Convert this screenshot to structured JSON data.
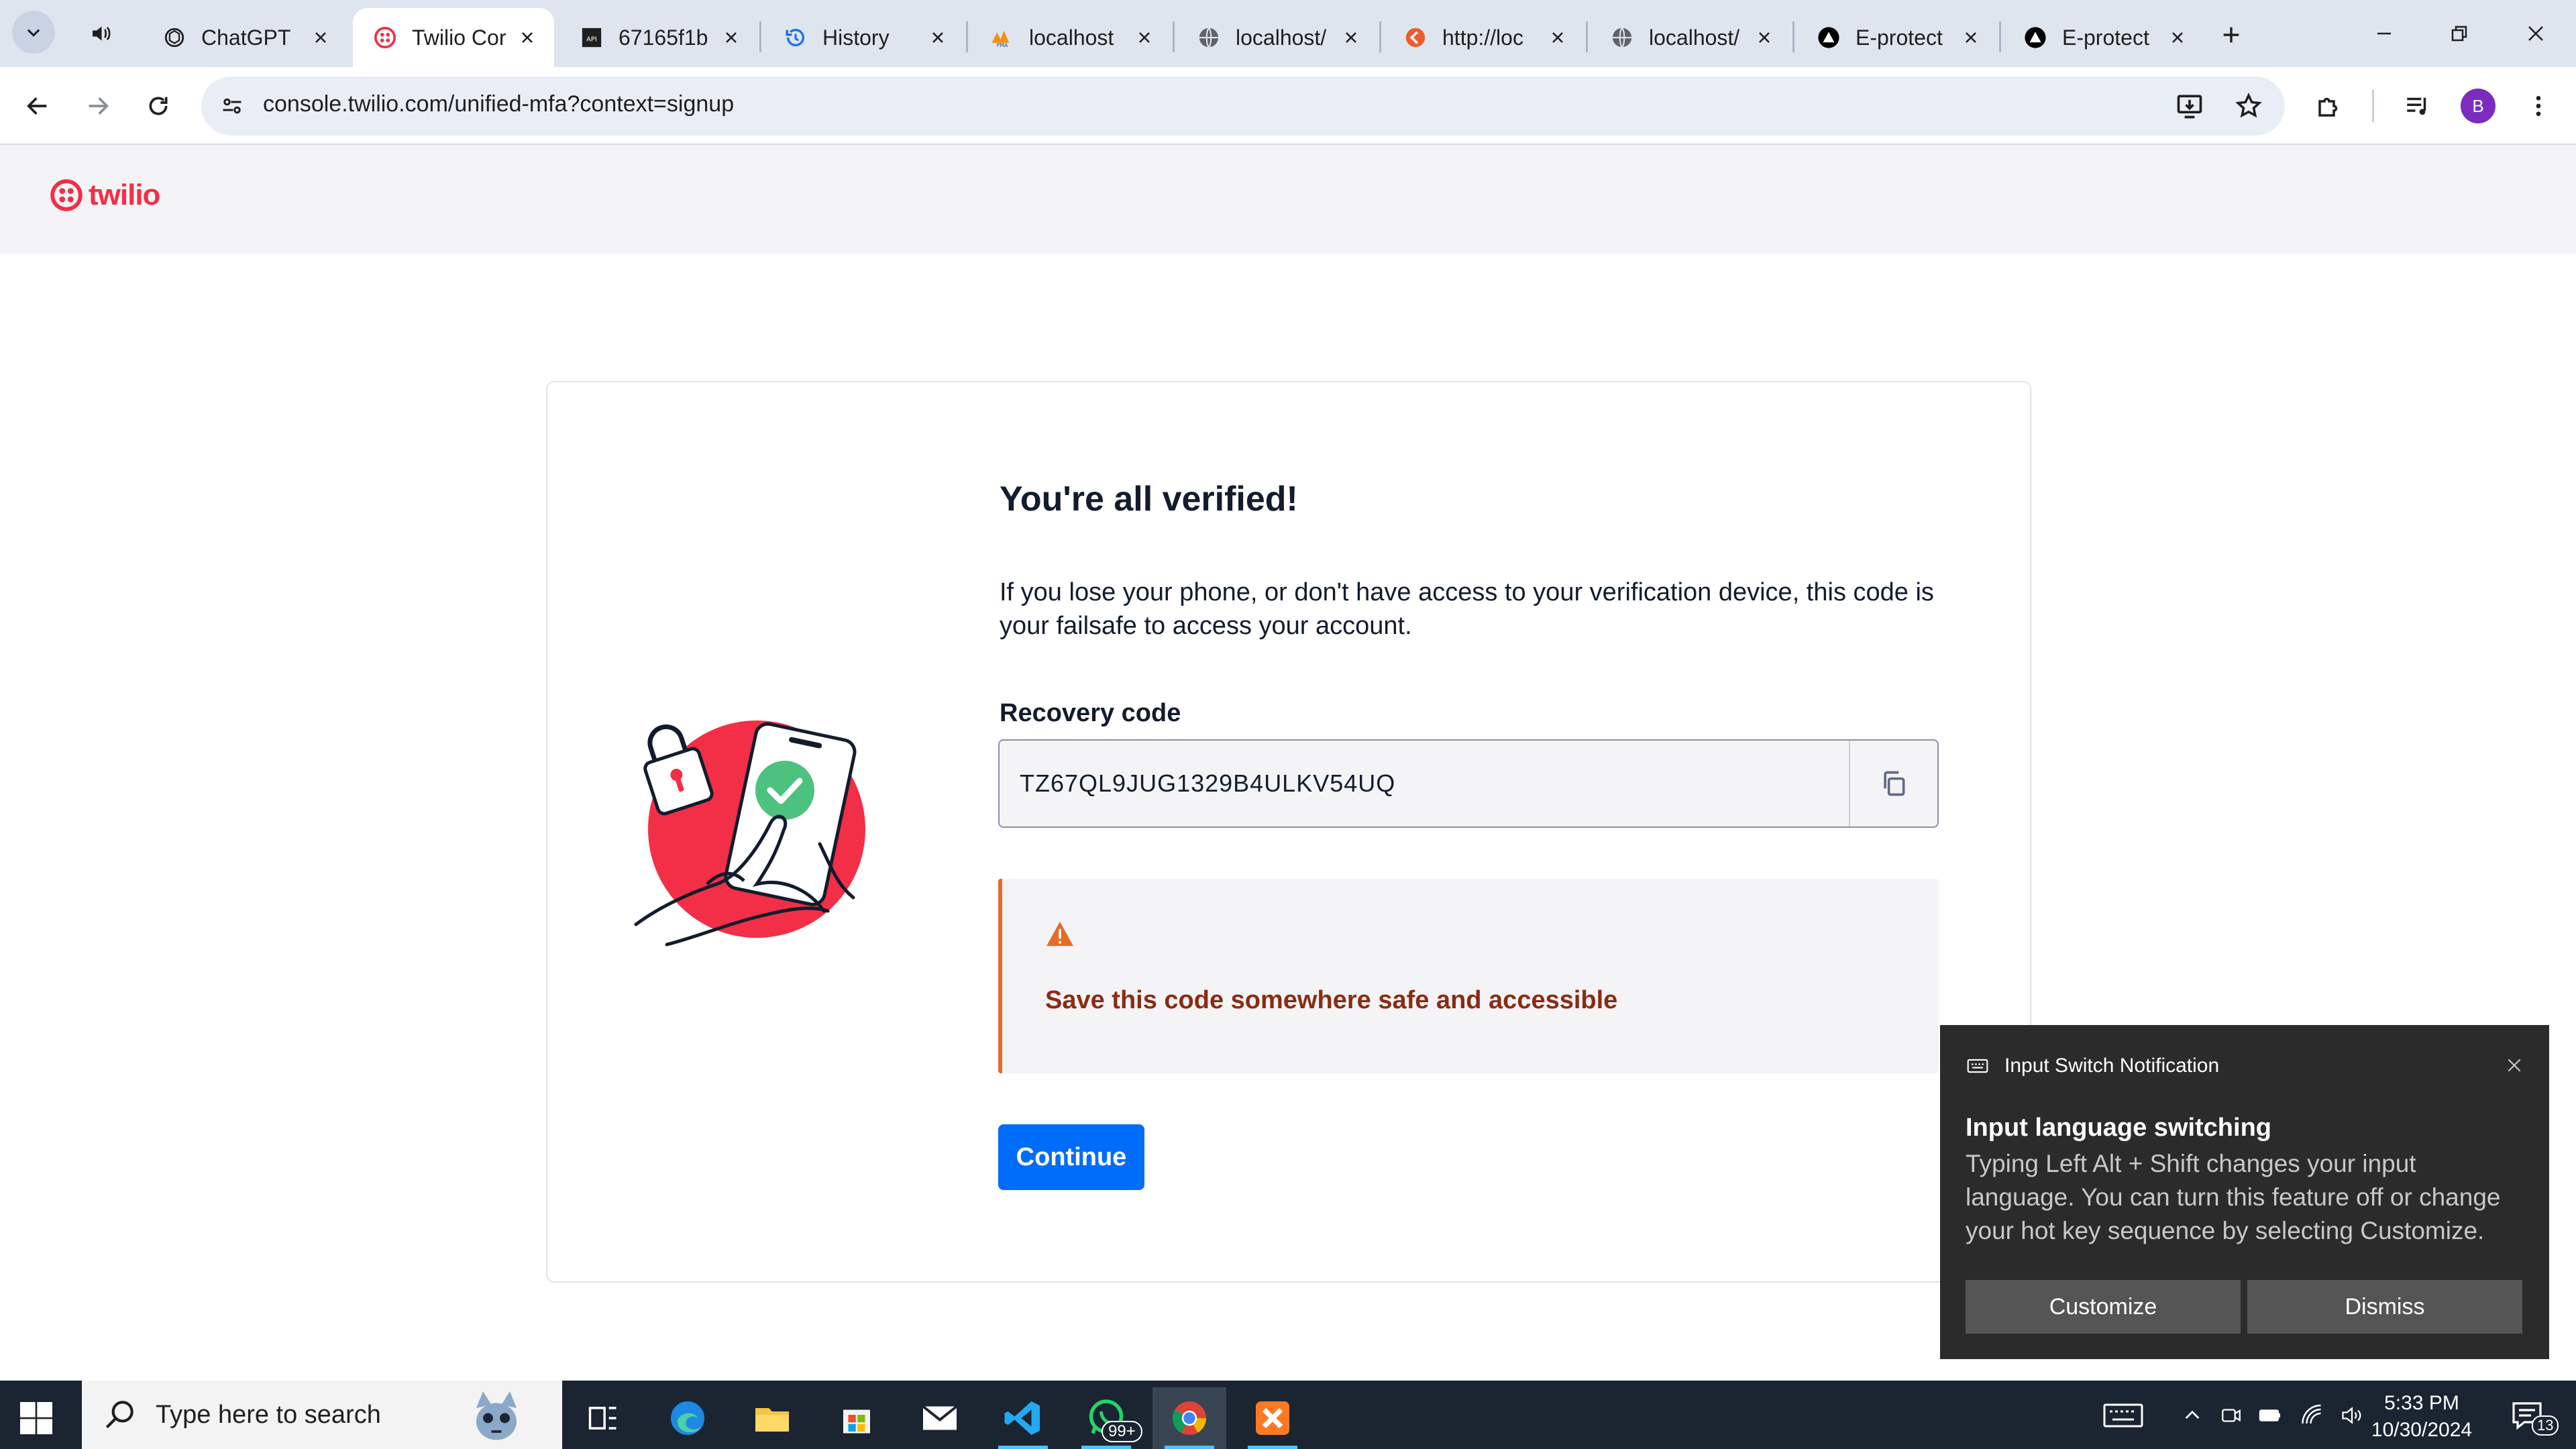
{
  "browser": {
    "tabs": [
      {
        "title": "ChatGPT",
        "icon": "chatgpt-icon"
      },
      {
        "title": "Twilio Cor",
        "icon": "twilio-icon",
        "active": true
      },
      {
        "title": "67165f1b",
        "icon": "api-doc-icon"
      },
      {
        "title": "History",
        "icon": "history-icon"
      },
      {
        "title": "localhost",
        "icon": "phpmyadmin-icon"
      },
      {
        "title": "localhost/",
        "icon": "globe-icon"
      },
      {
        "title": "http://loc",
        "icon": "red-app-icon"
      },
      {
        "title": "localhost/",
        "icon": "globe-icon"
      },
      {
        "title": "E-protect",
        "icon": "triangle-app-icon"
      },
      {
        "title": "E-protect",
        "icon": "triangle-app-icon"
      }
    ],
    "url": "console.twilio.com/unified-mfa?context=signup",
    "profile_initial": "B"
  },
  "header": {
    "logo_text": "twilio"
  },
  "card": {
    "heading": "You're all verified!",
    "description": "If you lose your phone, or don't have access to your verification device, this code is your failsafe to access your account.",
    "code_label": "Recovery code",
    "code_value": "TZ67QL9JUG1329B4ULKV54UQ",
    "warning": "Save this code somewhere safe and accessible",
    "continue_label": "Continue"
  },
  "notification": {
    "app_name": "Input Switch Notification",
    "title": "Input language switching",
    "body": "Typing Left Alt + Shift changes your input language. You can turn this feature off or change your hot key sequence by selecting Customize.",
    "customize_label": "Customize",
    "dismiss_label": "Dismiss"
  },
  "taskbar": {
    "search_placeholder": "Type here to search",
    "whatsapp_badge": "99+",
    "time": "5:33 PM",
    "date": "10/30/2024",
    "notification_count": "13"
  },
  "colors": {
    "twilio_red": "#f22f46",
    "continue_blue": "#006dfa",
    "warning_orange": "#e66c25",
    "warning_text": "#8c2b13",
    "check_green": "#4dc27e"
  }
}
